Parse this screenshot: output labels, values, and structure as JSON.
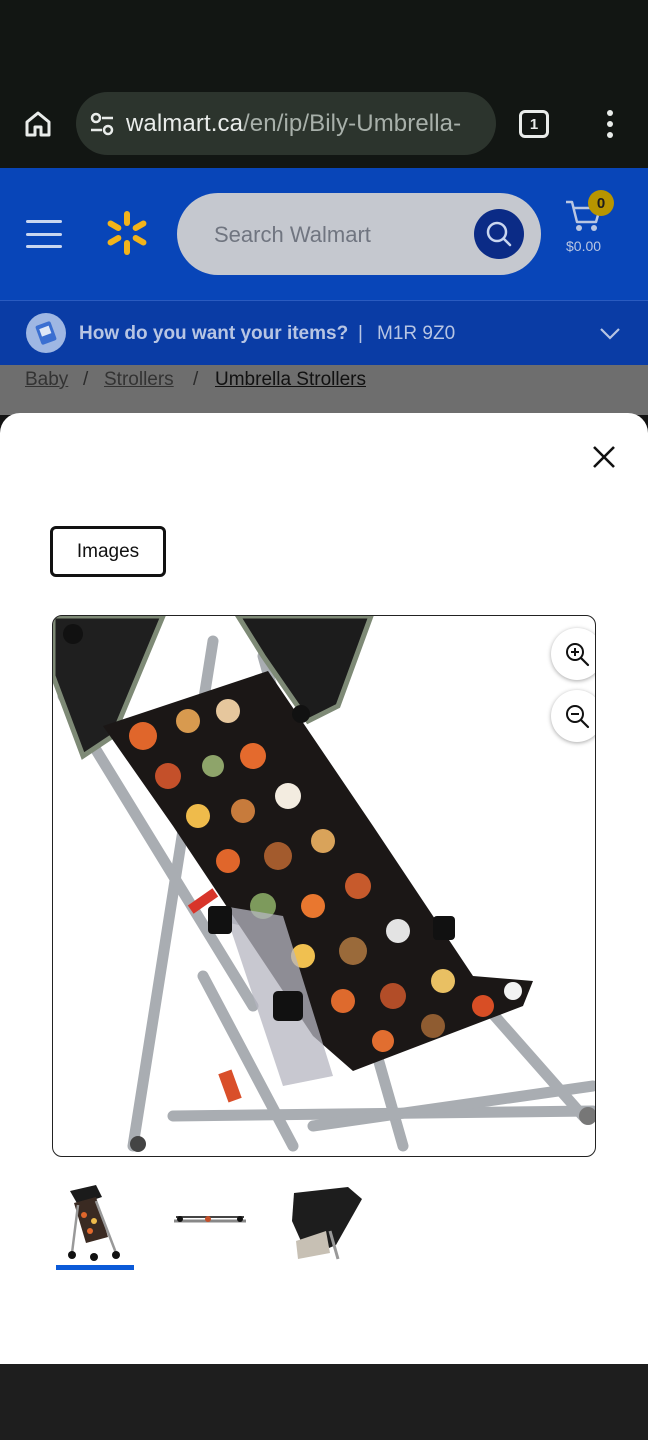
{
  "browser": {
    "url_domain": "walmart.ca",
    "url_path": "/en/ip/Bily-Umbrella-",
    "tab_count": "1"
  },
  "header": {
    "search_placeholder": "Search Walmart",
    "cart_count": "0",
    "cart_total": "$0.00"
  },
  "delivery": {
    "question": "How do you want your items?",
    "separator": "|",
    "postal_code": "M1R 9Z0"
  },
  "breadcrumb": {
    "items": [
      "Baby",
      "Strollers",
      "Umbrella Strollers"
    ],
    "separator": "/"
  },
  "modal": {
    "tab_label": "Images",
    "thumbnails": [
      "stroller-front",
      "stroller-folded",
      "stroller-canopy"
    ],
    "selected_thumbnail": 0
  },
  "colors": {
    "walmart_blue": "#0845b8",
    "spark_yellow": "#f2b31a",
    "selected_underline": "#0b5ad8"
  }
}
